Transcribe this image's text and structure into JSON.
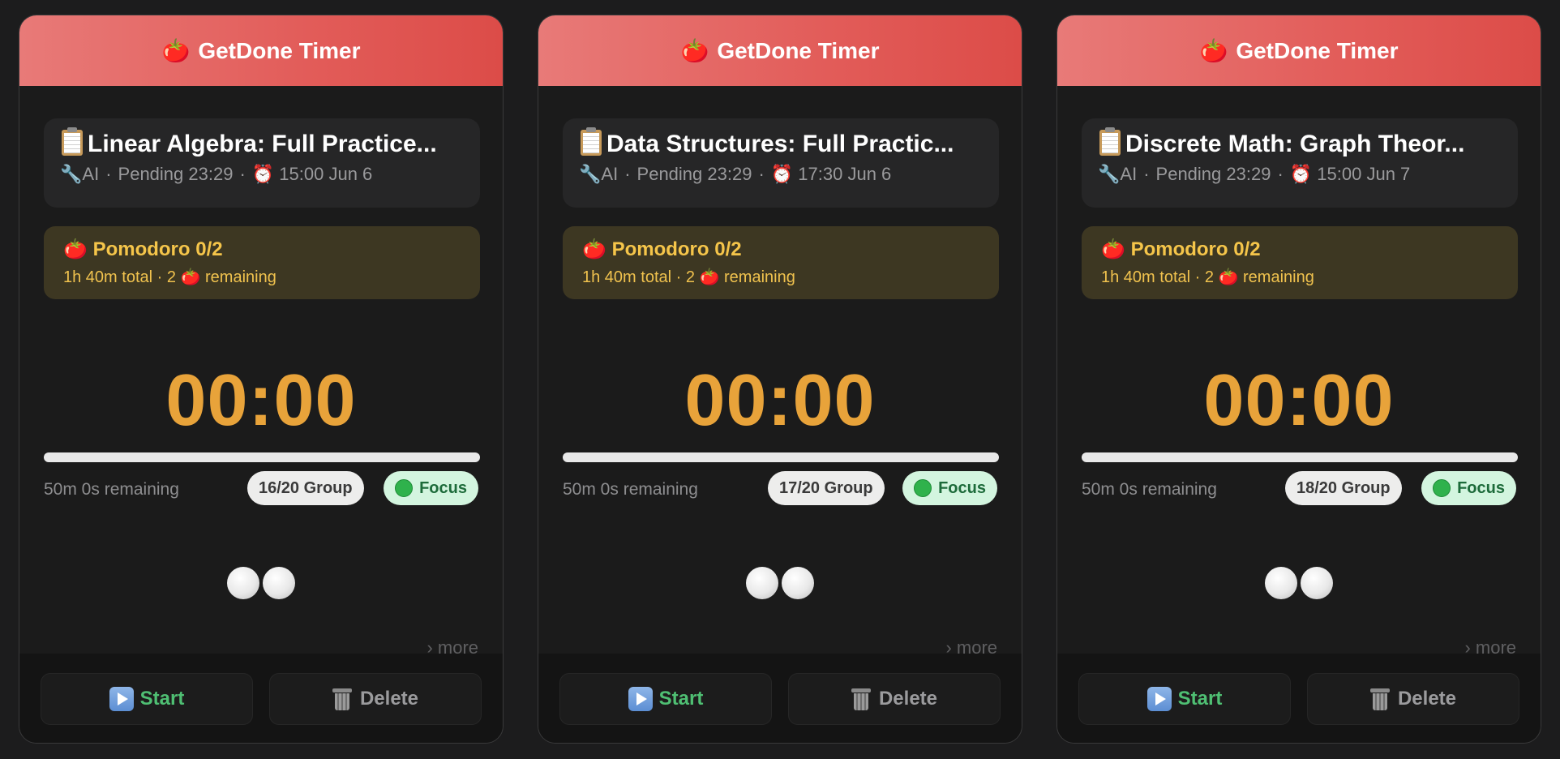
{
  "cards": [
    {
      "header": {
        "icon": "🍅",
        "title": "GetDone Timer"
      },
      "task": {
        "title": "Linear Algebra: Full Practice...",
        "type": "AI",
        "status": "Pending 23:29",
        "due": "15:00 Jun 6"
      },
      "pomodoro": {
        "title": "Pomodoro 0/2",
        "total": "1h 40m total",
        "remaining_count": "2",
        "remaining_label": "remaining"
      },
      "timer": {
        "display": "00:00",
        "progress": 0
      },
      "remaining_text": "50m 0s remaining",
      "group_badge": "16/20 Group",
      "focus_badge": "Focus",
      "more_link": "› more",
      "start_label": "Start",
      "delete_label": "Delete"
    },
    {
      "header": {
        "icon": "🍅",
        "title": "GetDone Timer"
      },
      "task": {
        "title": "Data Structures: Full Practic...",
        "type": "AI",
        "status": "Pending 23:29",
        "due": "17:30 Jun 6"
      },
      "pomodoro": {
        "title": "Pomodoro 0/2",
        "total": "1h 40m total",
        "remaining_count": "2",
        "remaining_label": "remaining"
      },
      "timer": {
        "display": "00:00",
        "progress": 0
      },
      "remaining_text": "50m 0s remaining",
      "group_badge": "17/20 Group",
      "focus_badge": "Focus",
      "more_link": "› more",
      "start_label": "Start",
      "delete_label": "Delete"
    },
    {
      "header": {
        "icon": "🍅",
        "title": "GetDone Timer"
      },
      "task": {
        "title": "Discrete Math: Graph Theor...",
        "type": "AI",
        "status": "Pending 23:29",
        "due": "15:00 Jun 7"
      },
      "pomodoro": {
        "title": "Pomodoro 0/2",
        "total": "1h 40m total",
        "remaining_count": "2",
        "remaining_label": "remaining"
      },
      "timer": {
        "display": "00:00",
        "progress": 0
      },
      "remaining_text": "50m 0s remaining",
      "group_badge": "18/20 Group",
      "focus_badge": "Focus",
      "more_link": "› more",
      "start_label": "Start",
      "delete_label": "Delete"
    }
  ],
  "icons": {
    "tomato": "tomato-icon",
    "clipboard": "clipboard-icon",
    "wrench": "wrench-icon",
    "alarm": "alarm-clock-icon",
    "play": "play-icon",
    "trash": "trash-icon",
    "green_dot": "green-circle-icon",
    "white_circle": "white-circle-icon"
  },
  "colors": {
    "header_start": "#e87a78",
    "header_end": "#dc4c48",
    "timer": "#e8a33a",
    "pomodoro_text": "#f5c54a",
    "start_text": "#4fbf73",
    "focus_bg": "#d3f5df"
  }
}
